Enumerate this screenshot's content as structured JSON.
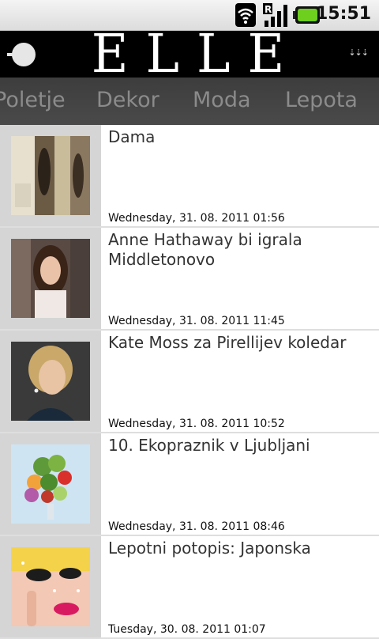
{
  "status_bar": {
    "time": "15:51",
    "icons": [
      "wifi-icon",
      "signal-roaming-icon",
      "battery-icon"
    ]
  },
  "header": {
    "logo": "ELLE",
    "back_icon": "back-icon",
    "menu_icon": "chevrons-down-icon"
  },
  "tabs": [
    "Poletje",
    "Dekor",
    "Moda",
    "Lepota"
  ],
  "articles": [
    {
      "title": "Dama",
      "date": "Wednesday, 31. 08. 2011 01:56"
    },
    {
      "title": "Anne Hathaway bi igrala Middletonovo",
      "date": "Wednesday, 31. 08. 2011 11:45"
    },
    {
      "title": "Kate Moss za Pirellijev koledar",
      "date": "Wednesday, 31. 08. 2011 10:52"
    },
    {
      "title": "10. Ekopraznik v Ljubljani",
      "date": "Wednesday, 31. 08. 2011 08:46"
    },
    {
      "title": "Lepotni potopis: Japonska",
      "date": "Tuesday, 30. 08. 2011 01:07"
    }
  ],
  "colors": {
    "header_bg": "#000000",
    "tabs_bg": "#444444",
    "tab_text": "#8b8b8b",
    "thumb_bg": "#d5d5d5"
  }
}
